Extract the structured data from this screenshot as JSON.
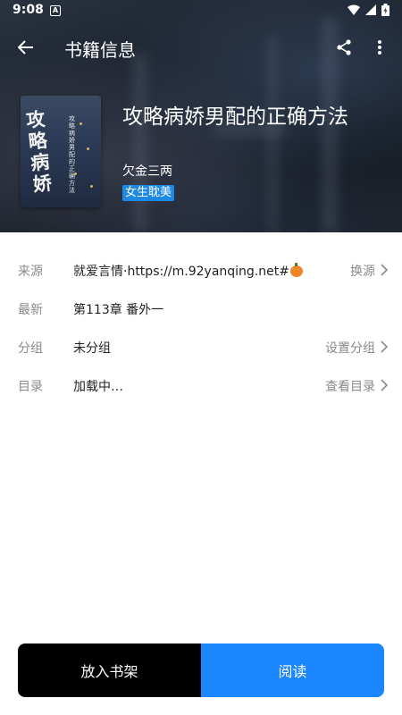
{
  "status_bar": {
    "time": "9:08",
    "notification_letter": "A"
  },
  "app_bar": {
    "title": "书籍信息",
    "icons": [
      "back-arrow-icon",
      "share-icon",
      "more-vert-icon"
    ]
  },
  "book": {
    "title": "攻略病娇男配的正确方法",
    "author": "欠金三两",
    "tag": "女生耽美",
    "cover_title": "攻略病娇",
    "cover_subtitle": "攻略病娇男配的正确方法"
  },
  "info_rows": [
    {
      "label": "来源",
      "value": "就爱言情·https://m.92yanqing.net#",
      "action": "换源"
    },
    {
      "label": "最新",
      "value": "第113章 番外一",
      "action": ""
    },
    {
      "label": "分组",
      "value": "未分组",
      "action": "设置分组"
    },
    {
      "label": "目录",
      "value": "加载中…",
      "action": "查看目录"
    }
  ],
  "bottom": {
    "shelf_label": "放入书架",
    "read_label": "阅读"
  },
  "colors": {
    "accent": "#1a86ff",
    "tag_bg": "#1e88e5",
    "shelf_bg": "#000000"
  }
}
